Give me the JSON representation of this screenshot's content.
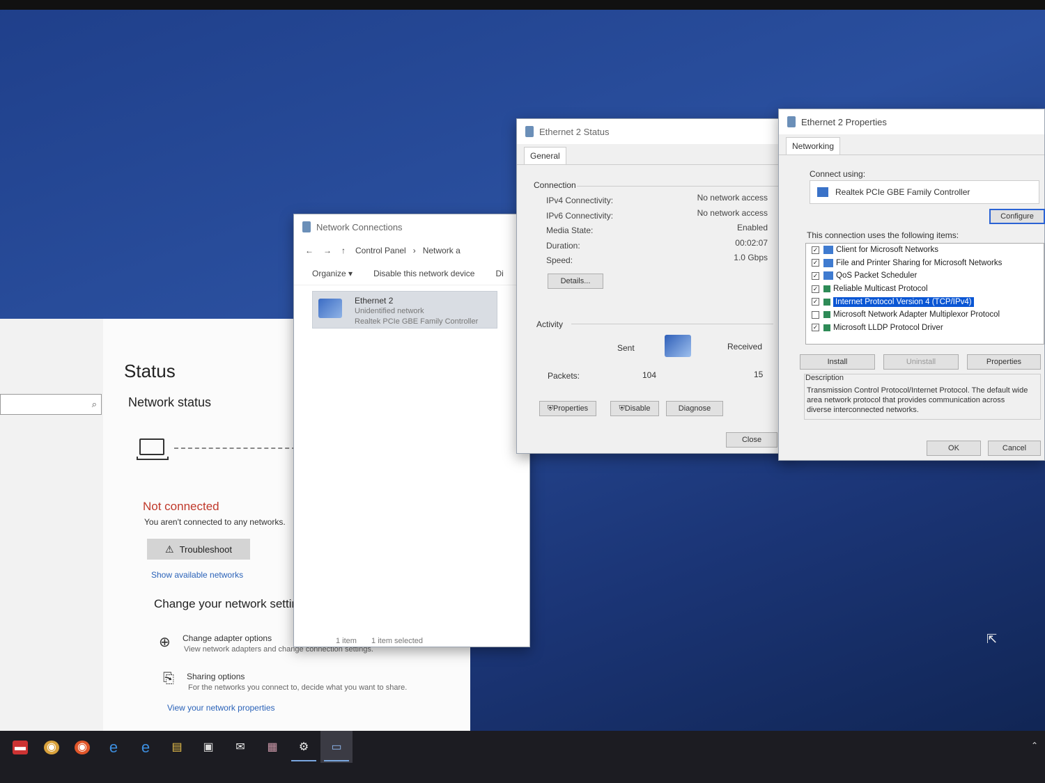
{
  "settings": {
    "title": "Status",
    "section": "Network status",
    "connection_state": "Not connected",
    "connection_detail": "You aren't connected to any networks.",
    "troubleshoot_label": "Troubleshoot",
    "show_networks_link": "Show available networks",
    "change_heading": "Change your network settin",
    "options": [
      {
        "title": "Change adapter options",
        "desc": "View network adapters and change connection settings.",
        "icon": "globe-icon"
      },
      {
        "title": "Sharing options",
        "desc": "For the networks you connect to, decide what you want to share.",
        "icon": "sharing-icon"
      }
    ],
    "view_props_link": "View your network properties"
  },
  "netconn": {
    "title": "Network Connections",
    "breadcrumb": [
      "Control Panel",
      "Network a"
    ],
    "toolbar": [
      "Organize ▾",
      "Disable this network device",
      "Di"
    ],
    "adapter": {
      "name": "Ethernet 2",
      "status": "Unidentified network",
      "device": "Realtek PCIe GBE Family Controller"
    },
    "status_items": "1 item",
    "status_selected": "1 item selected"
  },
  "ethstatus": {
    "title": "Ethernet 2 Status",
    "tab": "General",
    "connection_label": "Connection",
    "rows": [
      {
        "k": "IPv4 Connectivity:",
        "v": "No network access"
      },
      {
        "k": "IPv6 Connectivity:",
        "v": "No network access"
      },
      {
        "k": "Media State:",
        "v": "Enabled"
      },
      {
        "k": "Duration:",
        "v": "00:02:07"
      },
      {
        "k": "Speed:",
        "v": "1.0 Gbps"
      }
    ],
    "details_btn": "Details...",
    "activity_label": "Activity",
    "sent_label": "Sent",
    "received_label": "Received",
    "packets_label": "Packets:",
    "packets_sent": "104",
    "packets_received": "15",
    "btn_properties": "Properties",
    "btn_disable": "Disable",
    "btn_diagnose": "Diagnose",
    "btn_close": "Close"
  },
  "ethprops": {
    "title": "Ethernet 2 Properties",
    "tab": "Networking",
    "connect_using": "Connect using:",
    "adapter": "Realtek PCIe GBE Family Controller",
    "configure_btn": "Configure",
    "items_label": "This connection uses the following items:",
    "items": [
      {
        "label": "Client for Microsoft Networks",
        "checked": "✓"
      },
      {
        "label": "File and Printer Sharing for Microsoft Networks",
        "checked": "✓"
      },
      {
        "label": "QoS Packet Scheduler",
        "checked": "✓"
      },
      {
        "label": "Reliable Multicast Protocol",
        "checked": "✓"
      },
      {
        "label": "Internet Protocol Version 4 (TCP/IPv4)",
        "checked": "✓"
      },
      {
        "label": "Microsoft Network Adapter Multiplexor Protocol",
        "checked": ""
      },
      {
        "label": "Microsoft LLDP Protocol Driver",
        "checked": "✓"
      }
    ],
    "install_btn": "Install",
    "uninstall_btn": "Uninstall",
    "properties_btn": "Properties",
    "description_label": "Description",
    "description_text": "Transmission Control Protocol/Internet Protocol. The default wide area network protocol that provides communication across diverse interconnected networks.",
    "ok_btn": "OK",
    "cancel_btn": "Cancel"
  },
  "taskbar": {
    "icons": [
      "app-red-icon",
      "chrome-icon",
      "firefox-icon",
      "ie-icon",
      "edge-icon",
      "file-explorer-icon",
      "store-icon",
      "mail-icon",
      "app-icon",
      "settings-icon",
      "network-window-icon"
    ],
    "glyphs": [
      "▬",
      "◉",
      "◉",
      "e",
      "e",
      "▤",
      "▣",
      "✉",
      "▦",
      "⚙",
      "▭"
    ],
    "tray_glyph": "⌃"
  },
  "colors": {
    "desktop": "#1f3f8a",
    "accent_link": "#2a62b8",
    "error": "#c0392b",
    "selection": "#0a56d4"
  }
}
